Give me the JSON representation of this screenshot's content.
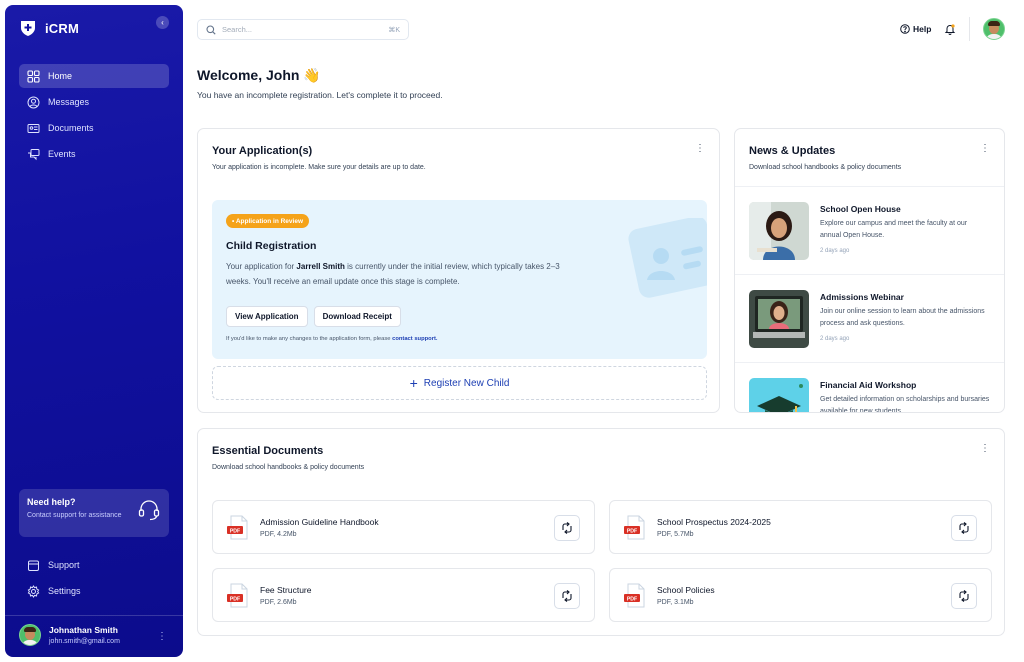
{
  "app": {
    "name": "iCRM"
  },
  "sidebar": {
    "items": [
      {
        "label": "Home",
        "icon": "grid-icon"
      },
      {
        "label": "Messages",
        "icon": "user-circle-icon"
      },
      {
        "label": "Documents",
        "icon": "id-card-icon"
      },
      {
        "label": "Events",
        "icon": "chat-icon"
      }
    ],
    "help": {
      "title": "Need help?",
      "subtitle": "Contact support for assistance"
    },
    "bottom": [
      {
        "label": "Support",
        "icon": "calendar-icon"
      },
      {
        "label": "Settings",
        "icon": "gear-icon"
      }
    ],
    "user": {
      "name": "Johnathan Smith",
      "email": "john.smith@gmail.com"
    }
  },
  "topbar": {
    "search_placeholder": "Search...",
    "shortcut": "⌘K",
    "help_label": "Help"
  },
  "welcome": {
    "title": "Welcome, John",
    "emoji": "👋",
    "subtitle": "You have an incomplete registration. Let's complete it to proceed."
  },
  "application": {
    "title": "Your Application(s)",
    "subtitle": "Your application is incomplete. Make sure your details are up to date.",
    "badge": "• Application in Review",
    "item_title": "Child Registration",
    "text_before": "Your application for ",
    "child_name": "Jarrell Smith",
    "text_after": " is currently under the initial review, which typically takes 2–3 weeks. You'll receive an email update once this stage is complete.",
    "view_button": "View Application",
    "download_button": "Download Receipt",
    "note_text": "If you'd like to make any changes to the application form, please ",
    "note_link": "contact support.",
    "register_label": "Register New Child"
  },
  "news": {
    "title": "News & Updates",
    "subtitle": "Download school handbooks & policy documents",
    "items": [
      {
        "title": "School Open House",
        "desc": "Explore our campus and meet the faculty at our annual Open House.",
        "time": "2 days ago"
      },
      {
        "title": "Admissions Webinar",
        "desc": "Join our online session to learn about the admissions process and ask questions.",
        "time": "2 days ago"
      },
      {
        "title": "Financial Aid Workshop",
        "desc": "Get detailed information on scholarships and bursaries available for new students.",
        "time": ""
      }
    ]
  },
  "documents": {
    "title": "Essential Documents",
    "subtitle": "Download school handbooks & policy documents",
    "items": [
      {
        "name": "Admission Guideline Handbook",
        "meta": "PDF, 4.2Mb",
        "type": "PDF"
      },
      {
        "name": "School Prospectus 2024-2025",
        "meta": "PDF, 5.7Mb",
        "type": "PDF"
      },
      {
        "name": "Fee Structure",
        "meta": "PDF, 2.6Mb",
        "type": "PDF"
      },
      {
        "name": "School Policies",
        "meta": "PDF, 3.1Mb",
        "type": "PDF"
      }
    ]
  },
  "colors": {
    "sidebar": "#1111a0",
    "accent": "#1d3fb3",
    "badge": "#f5a31a",
    "review_bg": "#e6f4fd",
    "pdf": "#d93025"
  }
}
